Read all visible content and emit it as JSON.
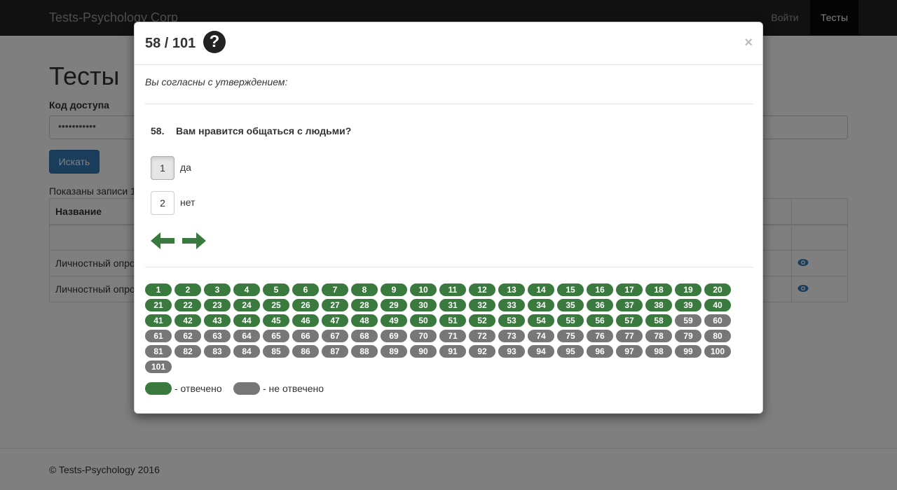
{
  "navbar": {
    "brand": "Tests-Psychology Corp",
    "login": "Войти",
    "tests": "Тесты"
  },
  "page": {
    "title": "Тесты",
    "access_label": "Код доступа",
    "access_value": "•••••••••••",
    "search_button": "Искать",
    "records_info": "Показаны записи 1",
    "table_header": "Название",
    "rows": [
      "Личностный опро",
      "Личностный опро"
    ],
    "footer": "© Tests-Psychology 2016"
  },
  "modal": {
    "progress": "58 / 101",
    "help_icon": "question-circle-icon",
    "close": "×",
    "instruction": "Вы согласны с утверждением:",
    "question_number": "58.",
    "question_text": "Вам нравится общаться с людьми?",
    "answers": [
      {
        "key": "1",
        "label": "да",
        "selected": true
      },
      {
        "key": "2",
        "label": "нет",
        "selected": false
      }
    ],
    "nav": {
      "prev": "arrow-left-icon",
      "next": "arrow-right-icon"
    },
    "question_count": 101,
    "answered_through": 58,
    "legend": {
      "answered": "- отвечено",
      "unanswered": "- не отвечено"
    },
    "colors": {
      "answered": "#3a7a3e",
      "unanswered": "#777777"
    }
  }
}
